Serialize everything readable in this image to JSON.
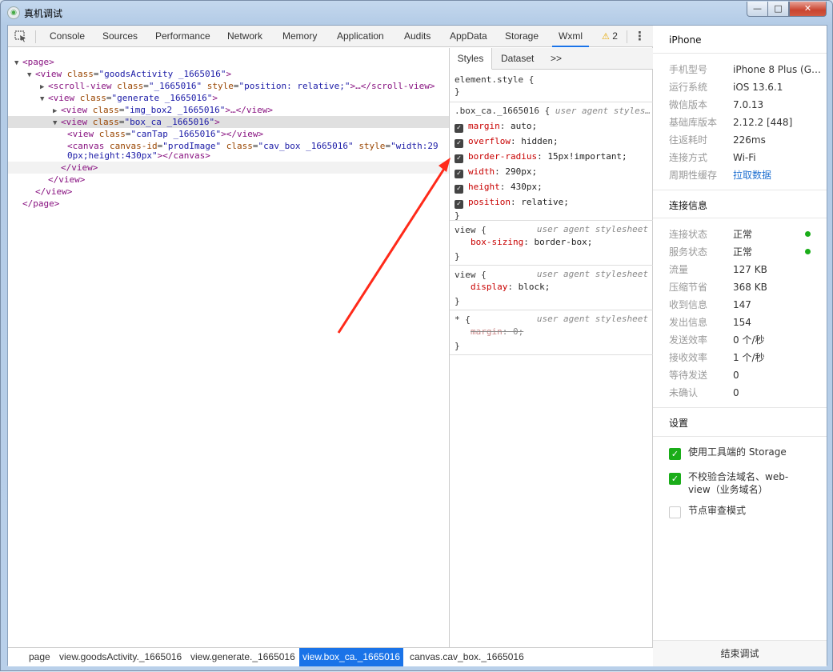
{
  "window": {
    "title": "真机调试",
    "min": "—",
    "max": "□",
    "close": "✕"
  },
  "devtools": {
    "tabs": [
      "Console",
      "Sources",
      "Performance",
      "Network",
      "Memory",
      "Application",
      "Audits",
      "AppData",
      "Storage",
      "Wxml"
    ],
    "active_tab": "Wxml",
    "warnings": "2"
  },
  "dom": {
    "page_open": "<page>",
    "l1_tag": "view",
    "l1_attr": "class",
    "l1_val": "\"goodsActivity _1665016\"",
    "l2_tag": "scroll-view",
    "l2_attr": "class",
    "l2_val": "\"_1665016\"",
    "l2_attr2": "style",
    "l2_val2": "\"position: relative;\"",
    "l2_rest": ">…</scroll-view>",
    "l3_tag": "view",
    "l3_attr": "class",
    "l3_val": "\"generate _1665016\"",
    "l4_tag": "view",
    "l4_attr": "class",
    "l4_val": "\"img_box2 _1665016\"",
    "l4_rest": ">…</view>",
    "l5_tag": "view",
    "l5_attr": "class",
    "l5_val": "\"box_ca _1665016\"",
    "l6_tag": "view",
    "l6_attr": "class",
    "l6_val": "\"canTap _1665016\"",
    "l6_rest": "></view>",
    "l7_tag": "canvas",
    "l7_attr": "canvas-id",
    "l7_val": "\"prodImage\"",
    "l7_attr2": "class",
    "l7_val2": "\"cav_box _1665016\"",
    "l7_attr3": "style",
    "l7_val3a": "\"width:29",
    "l7_val3b": "0px;height:430px\"",
    "l7_rest": "></canvas>",
    "close_view": "</view>",
    "close_page": "</page>"
  },
  "styles": {
    "tabs": [
      "Styles",
      "Dataset",
      ">>"
    ],
    "element_style": "element.style {",
    "close_brace": "}",
    "rule1_selector": ".box_ca._1665016 {",
    "rule1_source": "user agent styles…",
    "rule1_props": [
      {
        "name": "margin",
        "value": "auto;"
      },
      {
        "name": "overflow",
        "value": "hidden;"
      },
      {
        "name": "border-radius",
        "value": "15px!important;"
      },
      {
        "name": "width",
        "value": "290px;"
      },
      {
        "name": "height",
        "value": "430px;"
      },
      {
        "name": "position",
        "value": "relative;"
      }
    ],
    "ua_label": "user agent stylesheet",
    "rule2_selector": "view {",
    "rule2_prop": "box-sizing",
    "rule2_value": "border-box;",
    "rule3_selector": "view {",
    "rule3_prop": "display",
    "rule3_value": "block;",
    "rule4_selector": "* {",
    "rule4_prop": "margin",
    "rule4_value": "0;"
  },
  "breadcrumbs": [
    "page",
    "view.goodsActivity._1665016",
    "view.generate._1665016",
    "view.box_ca._1665016",
    "canvas.cav_box._1665016"
  ],
  "side": {
    "device": "iPhone",
    "info": [
      {
        "k": "手机型号",
        "v": "iPhone 8 Plus (G…"
      },
      {
        "k": "运行系统",
        "v": "iOS 13.6.1"
      },
      {
        "k": "微信版本",
        "v": "7.0.13"
      },
      {
        "k": "基础库版本",
        "v": "2.12.2 [448]"
      },
      {
        "k": "往返耗时",
        "v": "226ms"
      },
      {
        "k": "连接方式",
        "v": "Wi-Fi"
      },
      {
        "k": "周期性缓存",
        "v": "拉取数据"
      }
    ],
    "conn_title": "连接信息",
    "conn": [
      {
        "k": "连接状态",
        "v": "正常"
      },
      {
        "k": "服务状态",
        "v": "正常"
      },
      {
        "k": "流量",
        "v": "127 KB"
      },
      {
        "k": "压缩节省",
        "v": "368 KB"
      },
      {
        "k": "收到信息",
        "v": "147"
      },
      {
        "k": "发出信息",
        "v": "154"
      },
      {
        "k": "发送效率",
        "v": "0 个/秒"
      },
      {
        "k": "接收效率",
        "v": "1 个/秒"
      },
      {
        "k": "等待发送",
        "v": "0"
      },
      {
        "k": "未确认",
        "v": "0"
      }
    ],
    "settings_title": "设置",
    "settings": [
      {
        "label": "使用工具端的 Storage",
        "checked": true
      },
      {
        "label": "不校验合法域名、web-view（业务域名）",
        "checked": true
      },
      {
        "label": "节点审查模式",
        "checked": false
      }
    ],
    "end_button": "结束调试"
  },
  "colors": {
    "accent": "#1a73e8",
    "ok": "#1aad19",
    "annotation_arrow": "#ff2a1a"
  }
}
